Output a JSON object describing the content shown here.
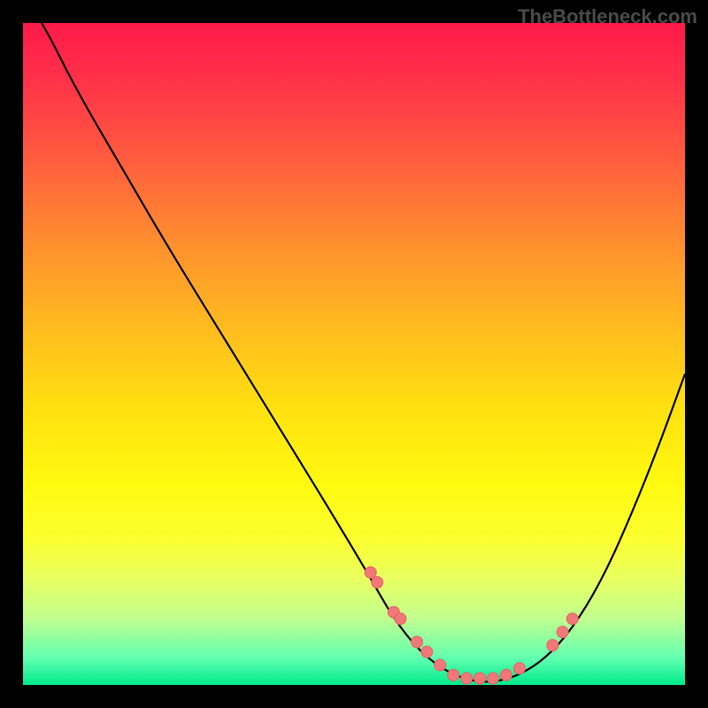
{
  "watermark": "TheBottleneck.com",
  "chart_data": {
    "type": "line",
    "title": "",
    "xlabel": "",
    "ylabel": "",
    "xlim": [
      0,
      100
    ],
    "ylim": [
      0,
      100
    ],
    "series": [
      {
        "name": "curve",
        "x": [
          0,
          3,
          8,
          15,
          22,
          30,
          38,
          46,
          52,
          56,
          60,
          64,
          68,
          72,
          76,
          80,
          84,
          88,
          92,
          96,
          100
        ],
        "y": [
          104,
          100,
          90,
          78,
          66,
          53,
          40,
          27,
          17,
          10,
          5,
          2,
          0.5,
          0.5,
          2,
          5,
          10,
          17,
          26,
          36,
          47
        ]
      }
    ],
    "markers": {
      "name": "highlighted-points",
      "x": [
        52.5,
        53.5,
        56,
        57,
        59.5,
        61,
        63,
        65,
        67,
        69,
        71,
        73,
        75,
        80,
        81.5,
        83
      ],
      "y": [
        17,
        15.5,
        11,
        10,
        6.5,
        5,
        3,
        1.5,
        1,
        1,
        1,
        1.5,
        2.5,
        6,
        8,
        10
      ]
    },
    "background_gradient": {
      "stops": [
        {
          "pos": 0,
          "color": "#ff1a4a"
        },
        {
          "pos": 20,
          "color": "#ff5a3f"
        },
        {
          "pos": 45,
          "color": "#ffb820"
        },
        {
          "pos": 70,
          "color": "#fffa10"
        },
        {
          "pos": 90,
          "color": "#c0ff90"
        },
        {
          "pos": 100,
          "color": "#00e98c"
        }
      ]
    }
  }
}
